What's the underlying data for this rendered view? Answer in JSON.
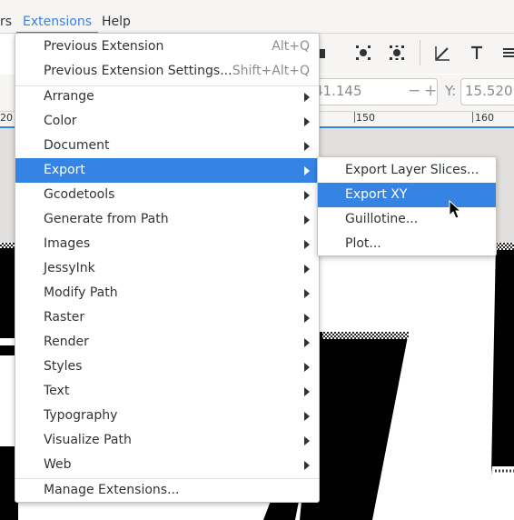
{
  "menubar": {
    "items": [
      {
        "label": "rs"
      },
      {
        "label": "Extensions"
      },
      {
        "label": "Help"
      }
    ]
  },
  "toolbar": {
    "icons": [
      "node-icon",
      "transform-icon",
      "pen-icon",
      "text-icon",
      "more-icon"
    ]
  },
  "controls": {
    "x_value": "41.145",
    "minus": "−",
    "plus": "+",
    "y_label": "Y:",
    "y_value": "15.520"
  },
  "ruler": {
    "labels": [
      "20",
      "150",
      "160"
    ]
  },
  "extensions_menu": {
    "top_items": [
      {
        "label": "Previous Extension",
        "accel": "Alt+Q"
      },
      {
        "label": "Previous Extension Settings...",
        "accel": "Shift+Alt+Q"
      }
    ],
    "items": [
      {
        "label": "Arrange"
      },
      {
        "label": "Color"
      },
      {
        "label": "Document"
      },
      {
        "label": "Export"
      },
      {
        "label": "Gcodetools"
      },
      {
        "label": "Generate from Path"
      },
      {
        "label": "Images"
      },
      {
        "label": "JessyInk"
      },
      {
        "label": "Modify Path"
      },
      {
        "label": "Raster"
      },
      {
        "label": "Render"
      },
      {
        "label": "Styles"
      },
      {
        "label": "Text"
      },
      {
        "label": "Typography"
      },
      {
        "label": "Visualize Path"
      },
      {
        "label": "Web"
      }
    ],
    "selected": "Export",
    "manage": "Manage Extensions..."
  },
  "export_submenu": {
    "items": [
      {
        "label": "Export Layer Slices..."
      },
      {
        "label": "Export XY"
      },
      {
        "label": "Guillotine..."
      },
      {
        "label": "Plot..."
      }
    ],
    "selected": "Export XY"
  },
  "colors": {
    "accent": "#3584e4",
    "menu_bg": "#ffffff",
    "chrome_bg": "#f6f5f4"
  }
}
